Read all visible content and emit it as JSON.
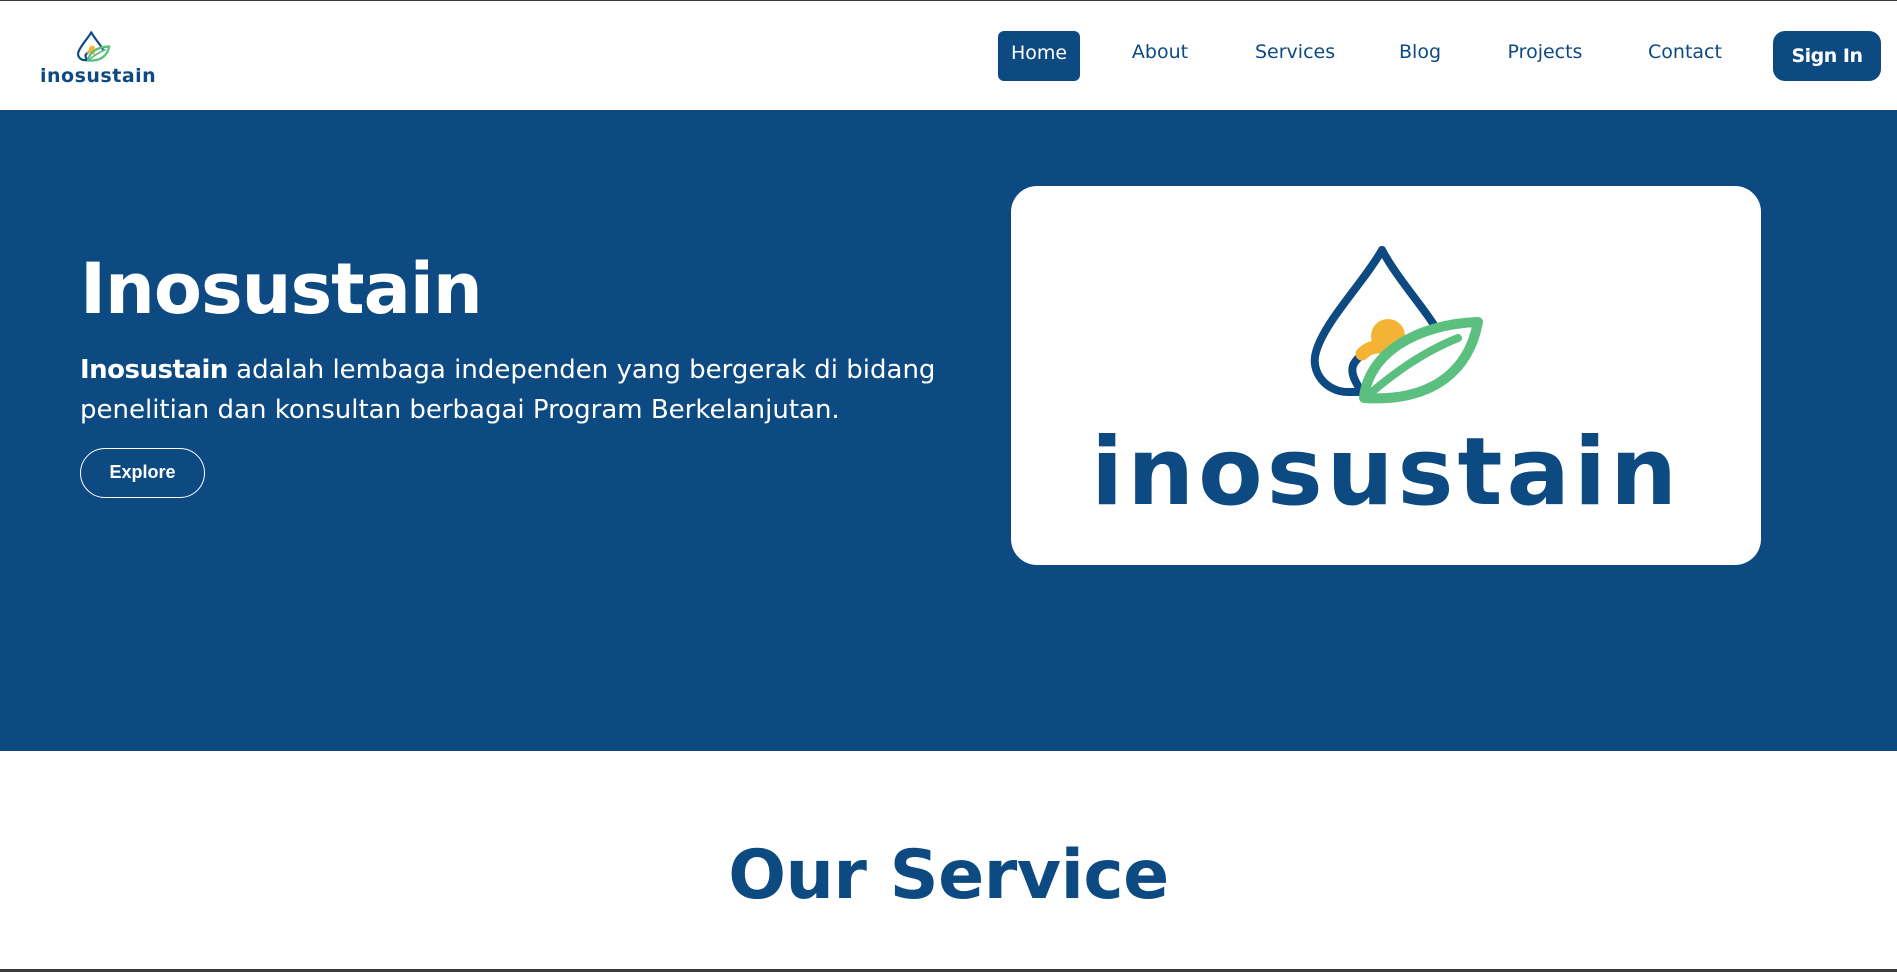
{
  "header": {
    "brand_name": "inosustain",
    "nav": [
      {
        "label": "Home",
        "active": true
      },
      {
        "label": "About",
        "active": false
      },
      {
        "label": "Services",
        "active": false
      },
      {
        "label": "Blog",
        "active": false
      },
      {
        "label": "Projects",
        "active": false
      },
      {
        "label": "Contact",
        "active": false
      }
    ],
    "signin_label": "Sign In"
  },
  "hero": {
    "title": "Inosustain",
    "desc_bold": "Inosustain",
    "desc_rest": " adalah lembaga independen yang bergerak di bidang penelitian dan konsultan berbagai Program Berkelanjutan.",
    "explore_label": "Explore",
    "card_wordmark": "inosustain"
  },
  "services": {
    "title": "Our Service"
  },
  "colors": {
    "primary": "#0e4a82",
    "leaf_green": "#5bbf7f",
    "sun_yellow": "#f5b335",
    "background": "#ffffff"
  },
  "icons": {
    "brand_logo": "water-drop-leaf-logo-icon"
  }
}
